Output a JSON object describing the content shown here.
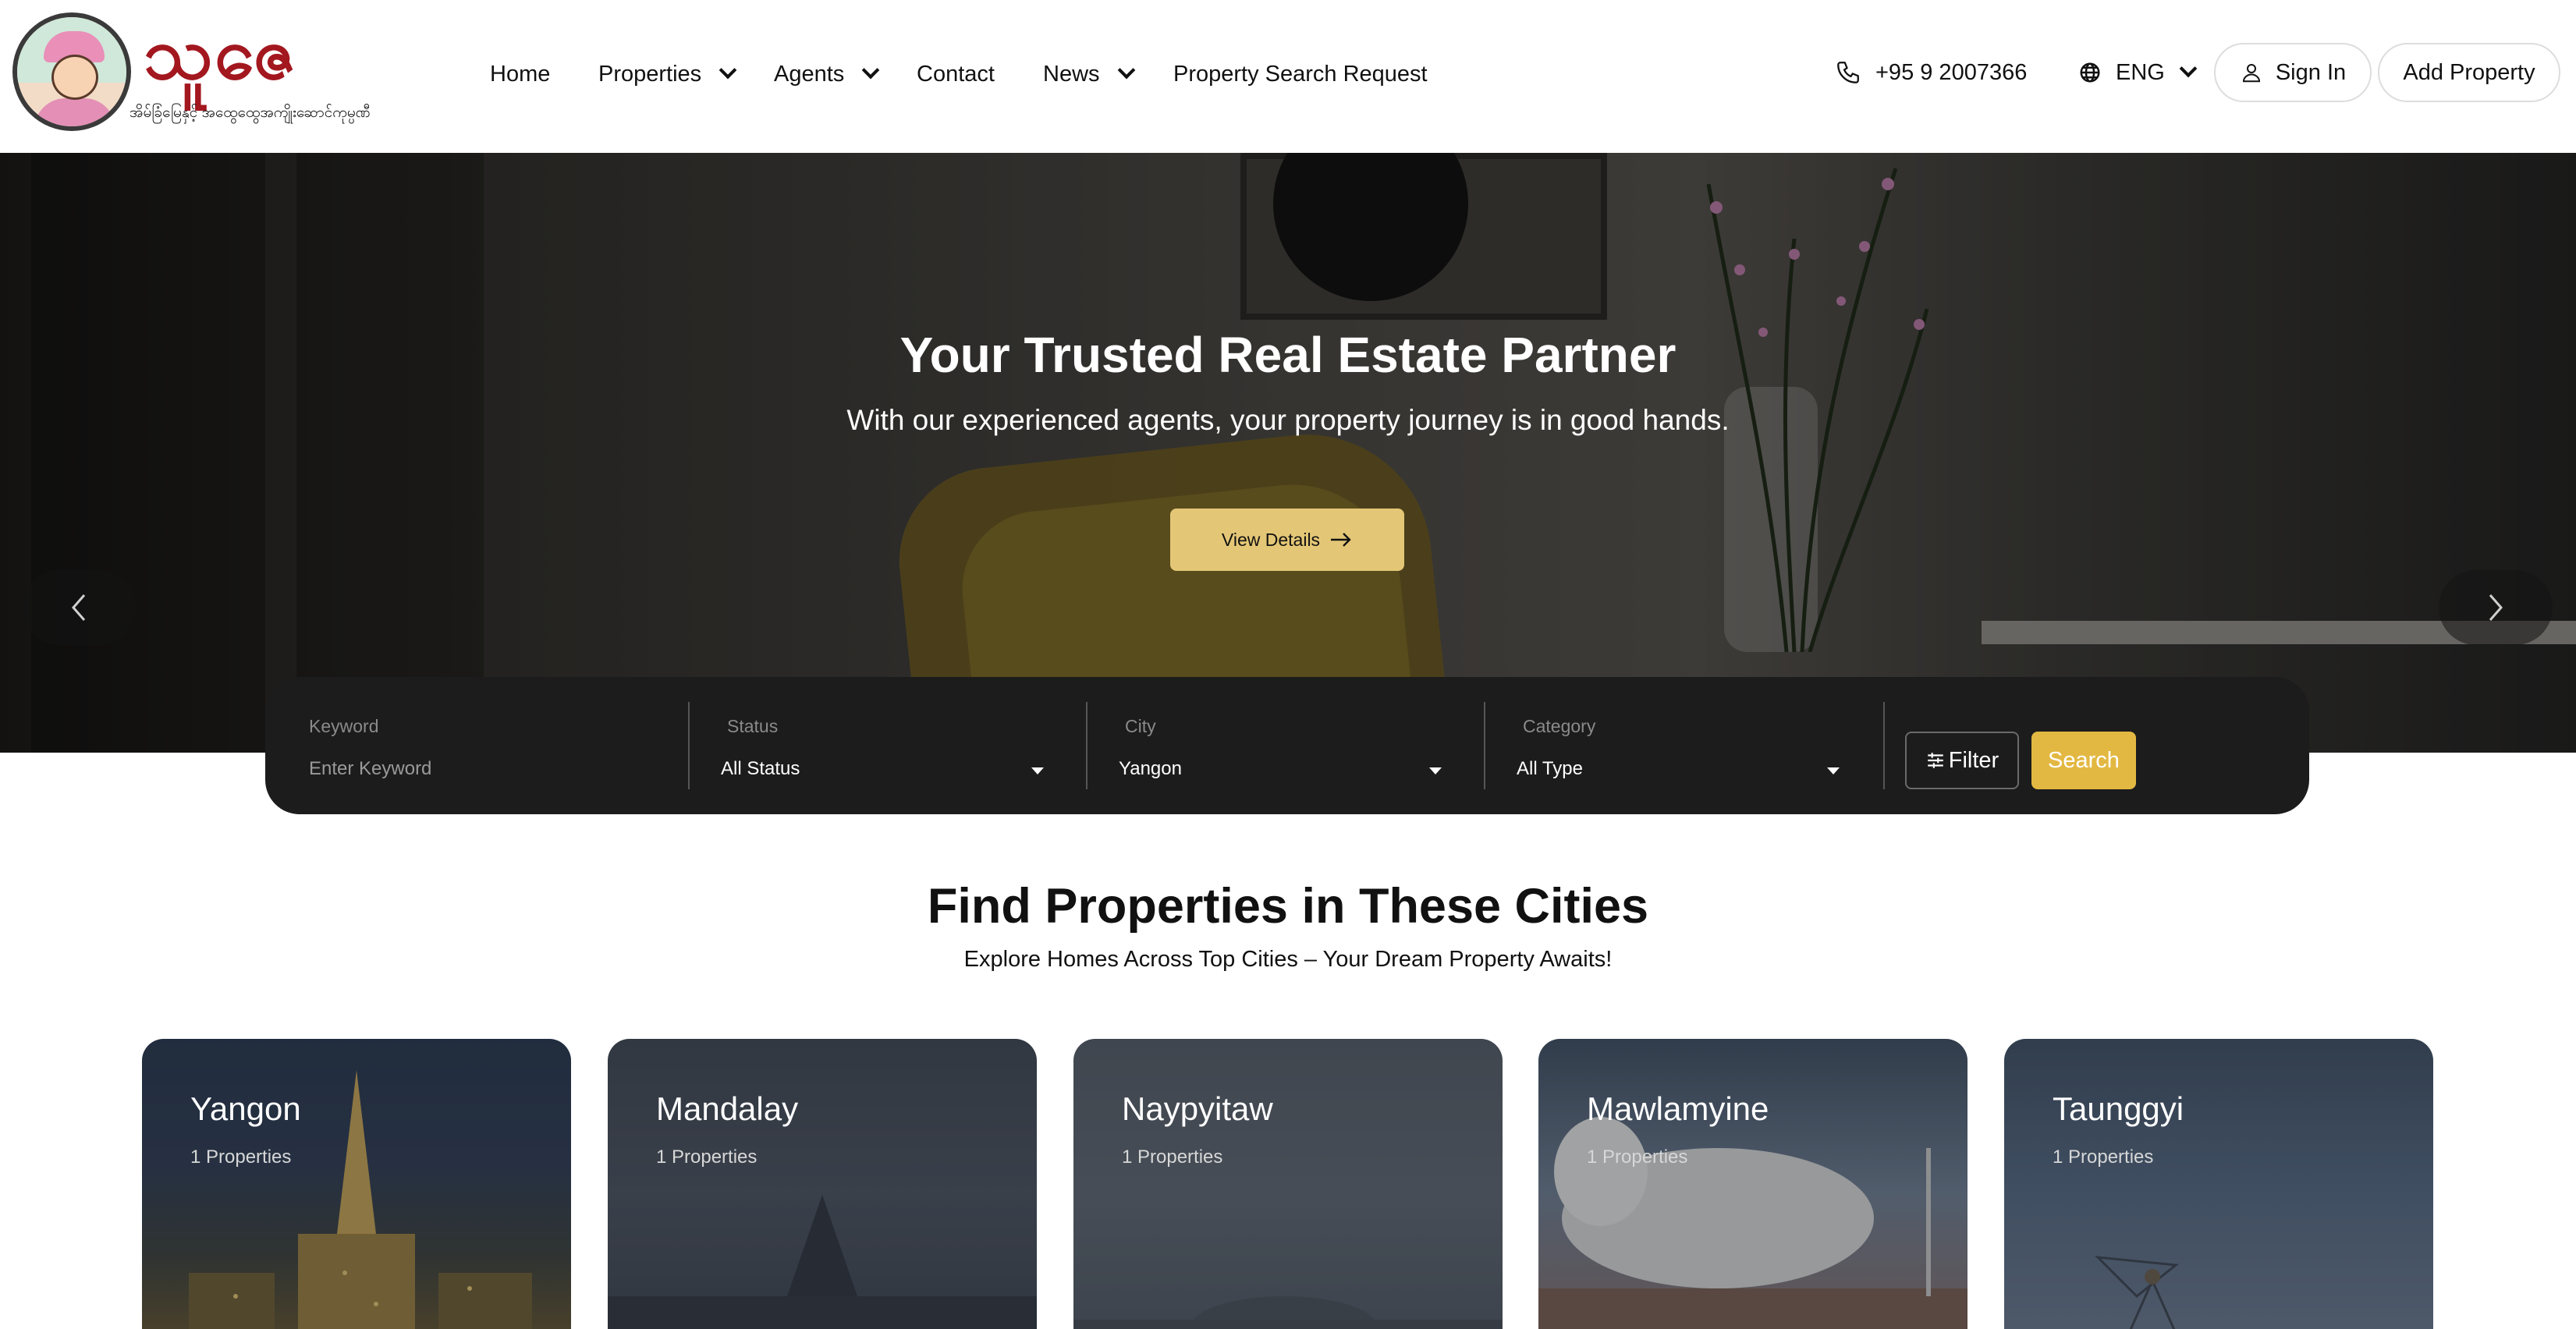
{
  "logo": {
    "title": "သူဇေ",
    "subtitle": "အိမ်ခြံမြေနှင့် အထွေထွေအကျိုးဆောင်ကုမ္ပဏီ"
  },
  "nav": {
    "items": [
      {
        "label": "Home"
      },
      {
        "label": "Properties"
      },
      {
        "label": "Agents"
      },
      {
        "label": "Contact"
      },
      {
        "label": "News"
      },
      {
        "label": "Property Search Request"
      }
    ]
  },
  "header": {
    "phone": "+95 9 2007366",
    "language": "ENG",
    "sign_in": "Sign In",
    "add_property": "Add Property"
  },
  "hero": {
    "title": "Your Trusted Real Estate Partner",
    "subtitle": "With our experienced agents, your property journey is in good hands.",
    "button": "View Details"
  },
  "search": {
    "keyword_label": "Keyword",
    "keyword_placeholder": "Enter Keyword",
    "status_label": "Status",
    "status_value": "All Status",
    "city_label": "City",
    "city_value": "Yangon",
    "category_label": "Category",
    "category_value": "All Type",
    "filter_button": "Filter",
    "search_button": "Search"
  },
  "cities_section": {
    "title": "Find Properties in These Cities",
    "subtitle": "Explore Homes Across Top Cities – Your Dream Property Awaits!",
    "cities": [
      {
        "name": "Yangon",
        "count": "1 Properties"
      },
      {
        "name": "Mandalay",
        "count": "1 Properties"
      },
      {
        "name": "Naypyitaw",
        "count": "1 Properties"
      },
      {
        "name": "Mawlamyine",
        "count": "1 Properties"
      },
      {
        "name": "Taunggyi",
        "count": "1 Properties"
      }
    ]
  },
  "colors": {
    "accent_gold": "#e3b842",
    "hero_button": "#e4c776",
    "logo_red": "#a3171f",
    "search_bar": "#1c1c1c"
  },
  "icons": {
    "phone": "phone-icon",
    "globe": "globe-icon",
    "user": "user-icon",
    "arrow_right": "arrow-right-icon",
    "prev": "chevron-left-icon",
    "next": "chevron-right-icon",
    "filter": "sliders-icon"
  }
}
